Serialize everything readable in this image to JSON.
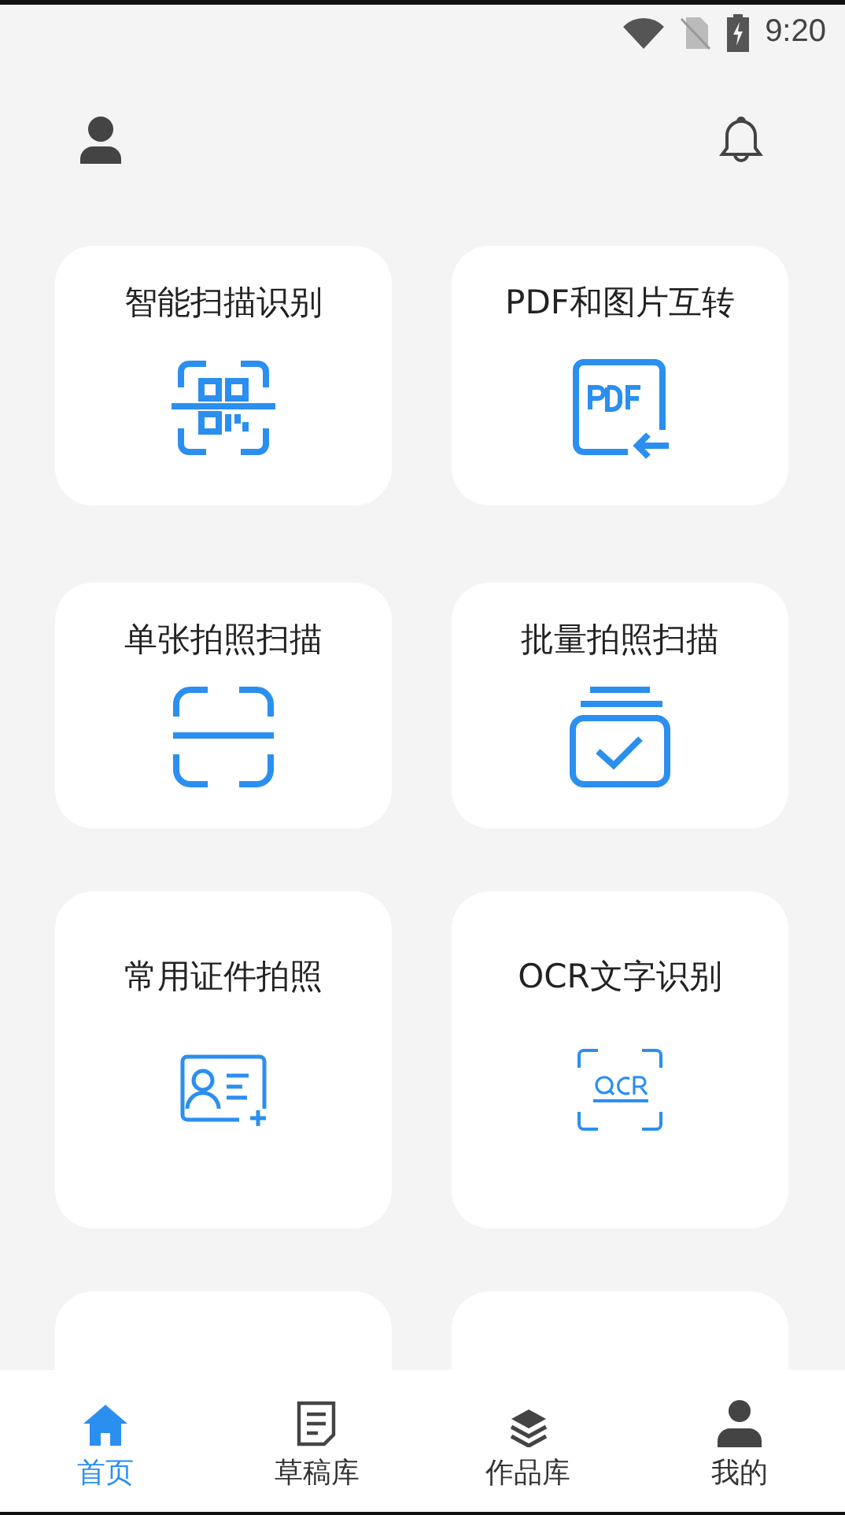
{
  "status_bar": {
    "time": "9:20"
  },
  "cards": [
    {
      "title": "智能扫描识别",
      "kind": "qr"
    },
    {
      "title": "PDF和图片互转",
      "kind": "pdf"
    },
    {
      "title": "单张拍照扫描",
      "kind": "single"
    },
    {
      "title": "批量拍照扫描",
      "kind": "batch"
    },
    {
      "title": "常用证件拍照",
      "kind": "id"
    },
    {
      "title": "OCR文字识别",
      "kind": "ocr"
    },
    {
      "kind": "cut"
    },
    {
      "kind": "cut"
    }
  ],
  "bottom_nav": [
    {
      "label": "首页",
      "kind": "home",
      "selected": true
    },
    {
      "label": "草稿库",
      "kind": "drafts",
      "selected": false
    },
    {
      "label": "作品库",
      "kind": "works",
      "selected": false
    },
    {
      "label": "我的",
      "kind": "me",
      "selected": false
    }
  ]
}
